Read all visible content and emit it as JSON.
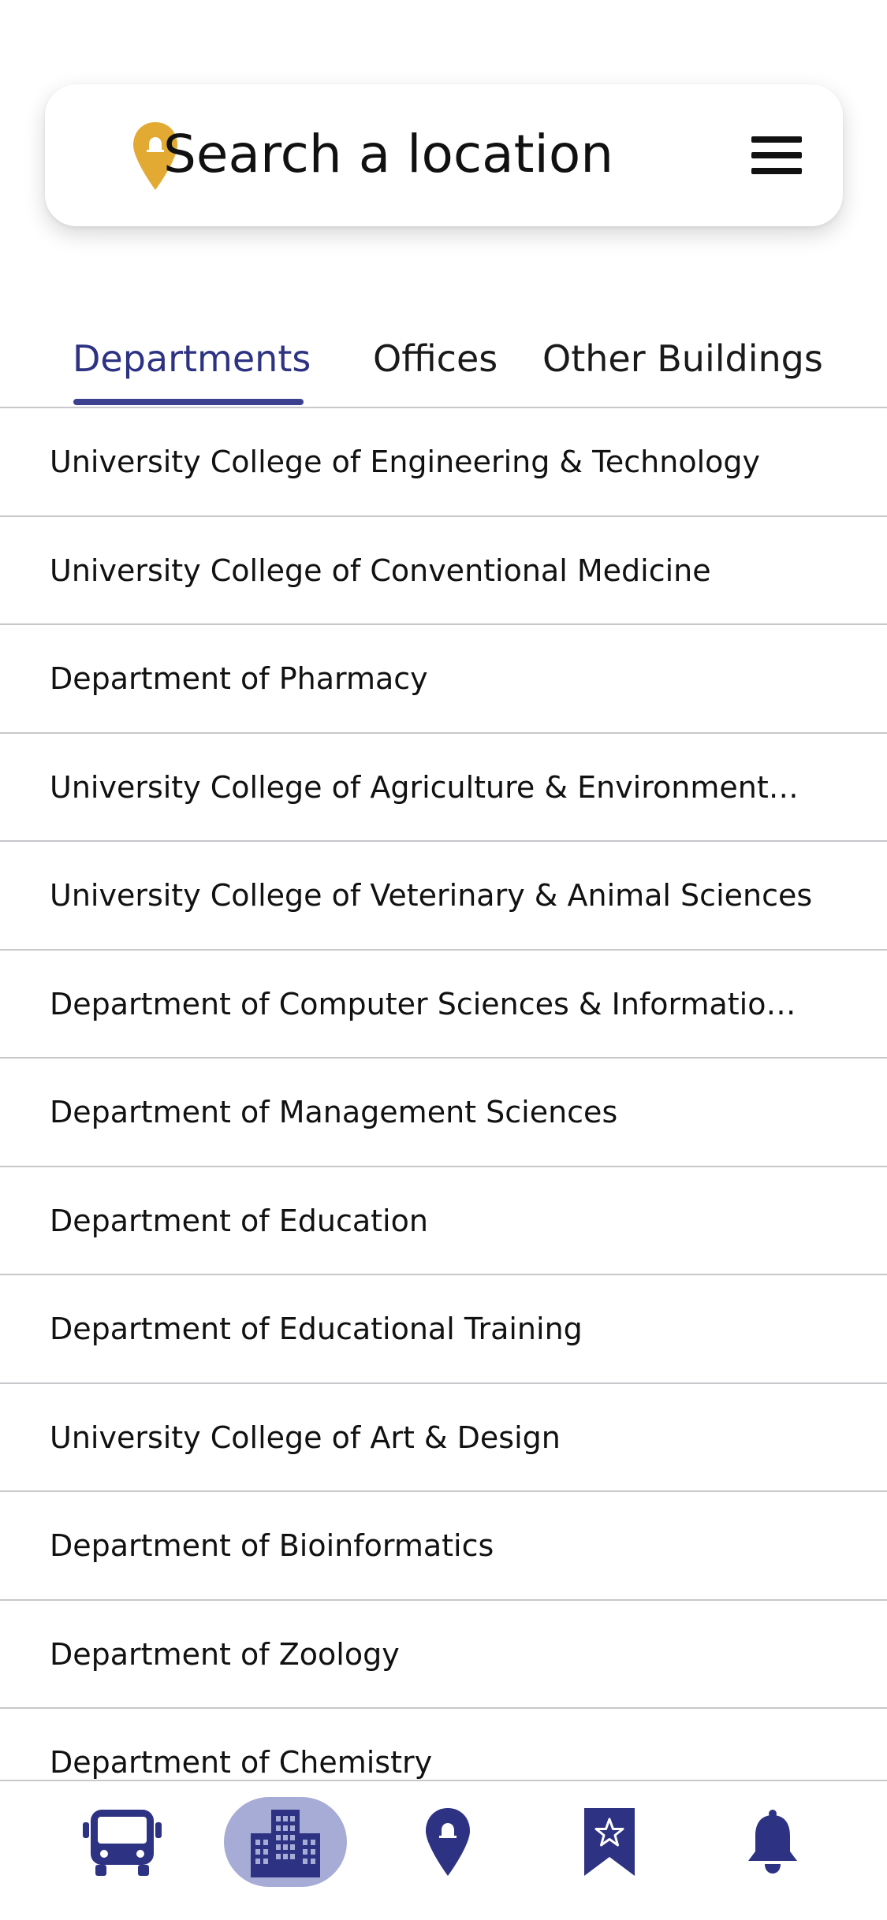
{
  "search": {
    "placeholder": "Search a location",
    "pin_color": "#e2aa33"
  },
  "tabs": [
    {
      "label": "Departments",
      "active": true
    },
    {
      "label": "Offices",
      "active": false
    },
    {
      "label": "Other Buildings",
      "active": false
    }
  ],
  "departments": [
    "University College of Engineering & Technology",
    "University College of Conventional Medicine",
    "Department of Pharmacy",
    "University College of Agriculture & Environmental Sciences",
    "University College of Veterinary & Animal Sciences",
    "Department of Computer Sciences & Information Technology",
    "Department of Management Sciences",
    "Department of Education",
    "Department of Educational Training",
    "University College of Art & Design",
    "Department of Bioinformatics",
    "Department of Zoology",
    "Department of Chemistry"
  ],
  "bottom_nav": [
    {
      "icon": "bus-icon",
      "active": false
    },
    {
      "icon": "buildings-icon",
      "active": true
    },
    {
      "icon": "location-pin-icon",
      "active": false
    },
    {
      "icon": "bookmark-star-icon",
      "active": false
    },
    {
      "icon": "bell-icon",
      "active": false
    }
  ],
  "colors": {
    "accent": "#2d3282",
    "active_pill": "#a7acd6",
    "divider": "#c8c8cc"
  }
}
